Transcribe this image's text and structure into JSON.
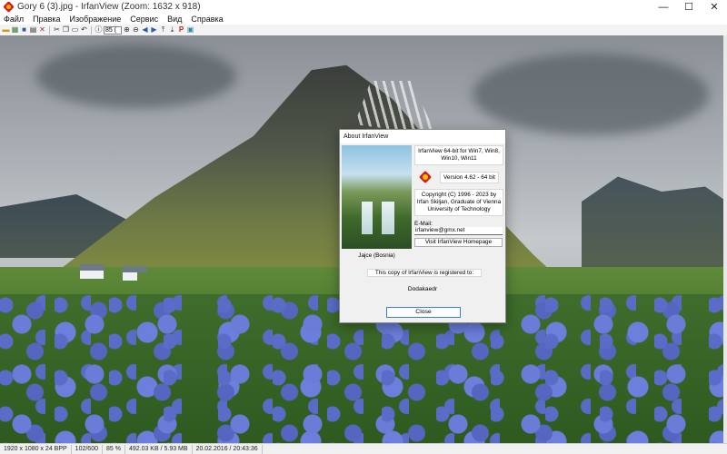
{
  "window": {
    "title": "Gory 6 (3).jpg - IrfanView (Zoom: 1632 x 918)",
    "minimize": "—",
    "maximize": "☐",
    "close": "✕"
  },
  "menu": [
    "Файл",
    "Правка",
    "Изображение",
    "Сервис",
    "Вид",
    "Справка"
  ],
  "toolbar": {
    "zoom_value": "85 (",
    "p_icon_label": "P"
  },
  "status": {
    "resolution": "1920 x 1080 x 24 BPP",
    "index": "102/600",
    "zoom": "85 %",
    "size": "492.03 KB / 5.93 MB",
    "datetime": "20.02.2016 / 20:43:36"
  },
  "about": {
    "title": "About  IrfanView",
    "edition": "IrfanView 64-bit for Win7, Win8, Win10, Win11",
    "version": "Version 4.62 - 64 bit",
    "copyright": "Copyright (C) 1996 - 2023 by Irfan Skiljan, Graduate of Vienna University of Technology",
    "email_label": "E-Mail:",
    "email_value": "irfanview@gmx.net",
    "homepage_button": "Visit IrfanView Homepage",
    "photo_caption": "Jajce (Bosnia)",
    "registered_text": "This copy of IrfanView is registered to:",
    "registered_name": "Dodakaedr",
    "close_button": "Close"
  }
}
